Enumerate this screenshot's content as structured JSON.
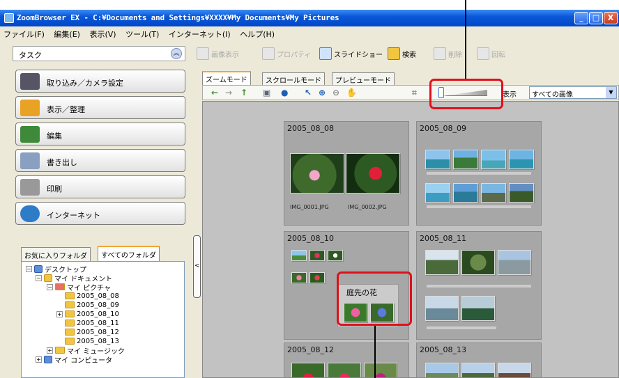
{
  "window": {
    "title": "ZoomBrowser EX  -  C:¥Documents and Settings¥XXXX¥My Documents¥My Pictures",
    "controls": [
      "_",
      "□",
      "X"
    ]
  },
  "menu": [
    "ファイル(F)",
    "編集(E)",
    "表示(V)",
    "ツール(T)",
    "インターネット(I)",
    "ヘルプ(H)"
  ],
  "toolbar": {
    "image_view": "画像表示",
    "properties": "プロパティ",
    "slideshow": "スライドショー",
    "search": "検索",
    "delete": "削除",
    "rotate": "回転"
  },
  "tasks": {
    "header": "タスク",
    "items": [
      "取り込み／カメラ設定",
      "表示／整理",
      "編集",
      "書き出し",
      "印刷",
      "インターネット"
    ]
  },
  "folder_tabs": [
    "お気に入りフォルダ",
    "すべてのフォルダ"
  ],
  "tree": {
    "desktop": "デスクトップ",
    "my_documents": "マイ ドキュメント",
    "my_pictures": "マイ ピクチャ",
    "folders": [
      "2005_08_08",
      "2005_08_09",
      "2005_08_10",
      "2005_08_11",
      "2005_08_12",
      "2005_08_13"
    ],
    "my_music": "マイ ミュージック",
    "my_computer": "マイ コンピュータ"
  },
  "view_tabs": [
    "ズームモード",
    "スクロールモード",
    "プレビューモード"
  ],
  "viewbar": {
    "show_label": "表示",
    "filter_value": "すべての画像"
  },
  "groups": [
    {
      "date": "2005_08_08",
      "captions": [
        "IMG_0001.JPG",
        "IMG_0002.JPG"
      ]
    },
    {
      "date": "2005_08_09"
    },
    {
      "date": "2005_08_10"
    },
    {
      "date": "2005_08_11"
    },
    {
      "date": "2005_08_12"
    },
    {
      "date": "2005_08_13"
    }
  ],
  "stack_title": "庭先の花",
  "colors": {
    "highlight": "#e0101a",
    "title_bar": "#0a58d8",
    "content_bg": "#c2c2c2"
  }
}
